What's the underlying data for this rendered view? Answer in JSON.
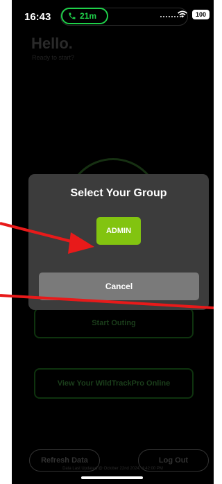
{
  "status_bar": {
    "time": "16:43",
    "call_duration": "21m",
    "battery_level": "100",
    "icons": [
      "phone-icon",
      "wifi-icon",
      "battery-icon"
    ]
  },
  "home": {
    "greeting": "Hello.",
    "subtitle": "Ready to start?",
    "start_outing_label": "Start Outing",
    "view_online_label": "View Your WildTrackPro Online",
    "refresh_label": "Refresh Data",
    "logout_label": "Log Out",
    "last_updated": "Data Last Updated @ October 22nd 2024, 4:42:00 PM"
  },
  "dialog": {
    "title": "Select Your Group",
    "group_option": "ADMIN",
    "cancel_label": "Cancel"
  },
  "annotations": {
    "arrow_color": "#e81a1a",
    "icons": [
      "red-arrow-icon",
      "red-line-icon"
    ]
  },
  "colors": {
    "accent_green": "#82c410",
    "call_green": "#1fd14a",
    "modal_bg": "#3c3c3c"
  }
}
